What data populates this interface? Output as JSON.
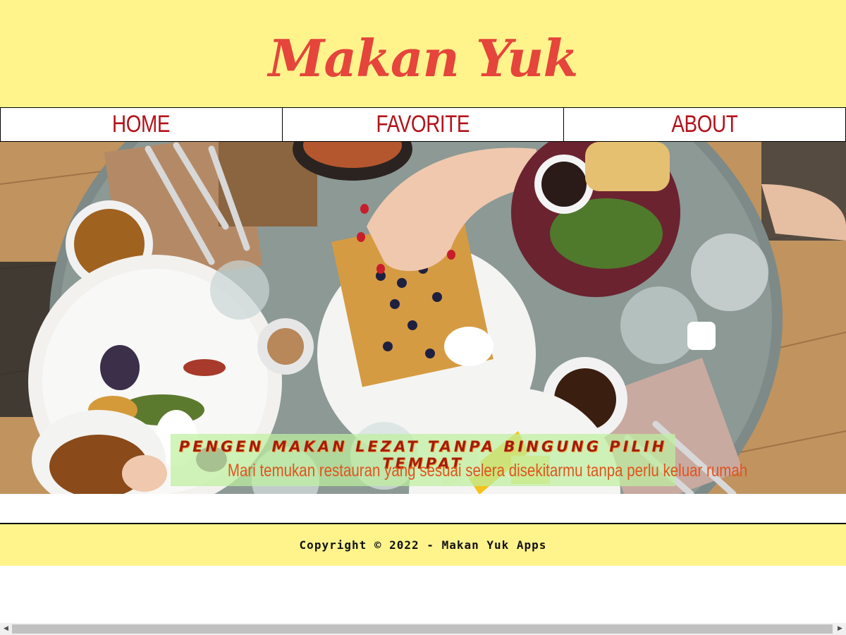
{
  "header": {
    "brand": "Makan Yuk"
  },
  "nav": {
    "items": [
      {
        "label": "HOME"
      },
      {
        "label": "FAVORITE"
      },
      {
        "label": "ABOUT"
      }
    ]
  },
  "hero": {
    "image": "food-table-photo",
    "title": "PENGEN MAKAN LEZAT TANPA BINGUNG PILIH TEMPAT",
    "subtitle": "Mari temukan restauran yang sesuai selera disekitarmu tanpa perlu keluar rumah"
  },
  "footer": {
    "copyright": "Copyright © 2022 - Makan Yuk Apps"
  },
  "colors": {
    "header_bg": "#fff48c",
    "brand": "#e5453b",
    "nav_text": "#b3121b",
    "caption_sub": "#e0541e"
  }
}
